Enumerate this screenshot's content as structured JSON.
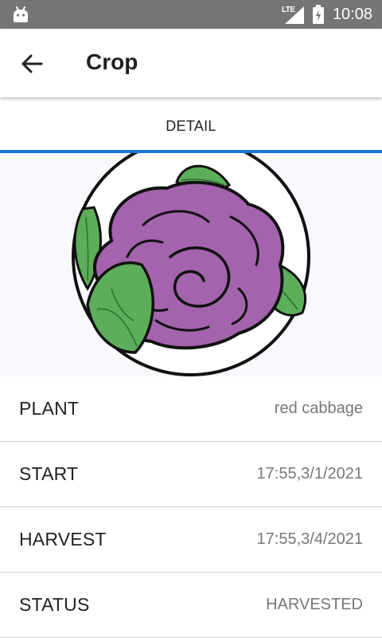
{
  "status_bar": {
    "network": "LTE",
    "time": "10:08"
  },
  "app_bar": {
    "title": "Crop"
  },
  "tabs": [
    {
      "label": "DETAIL",
      "selected": true
    }
  ],
  "image": {
    "subject": "red cabbage illustration"
  },
  "details": [
    {
      "label": "PLANT",
      "value": "red cabbage"
    },
    {
      "label": "START",
      "value": "17:55,3/1/2021"
    },
    {
      "label": "HARVEST",
      "value": "17:55,3/4/2021"
    },
    {
      "label": "STATUS",
      "value": "HARVESTED"
    }
  ],
  "colors": {
    "status_bar": "#757575",
    "tab_indicator": "#1976d2",
    "cabbage": "#a463ad",
    "leaf": "#5cae5a"
  }
}
